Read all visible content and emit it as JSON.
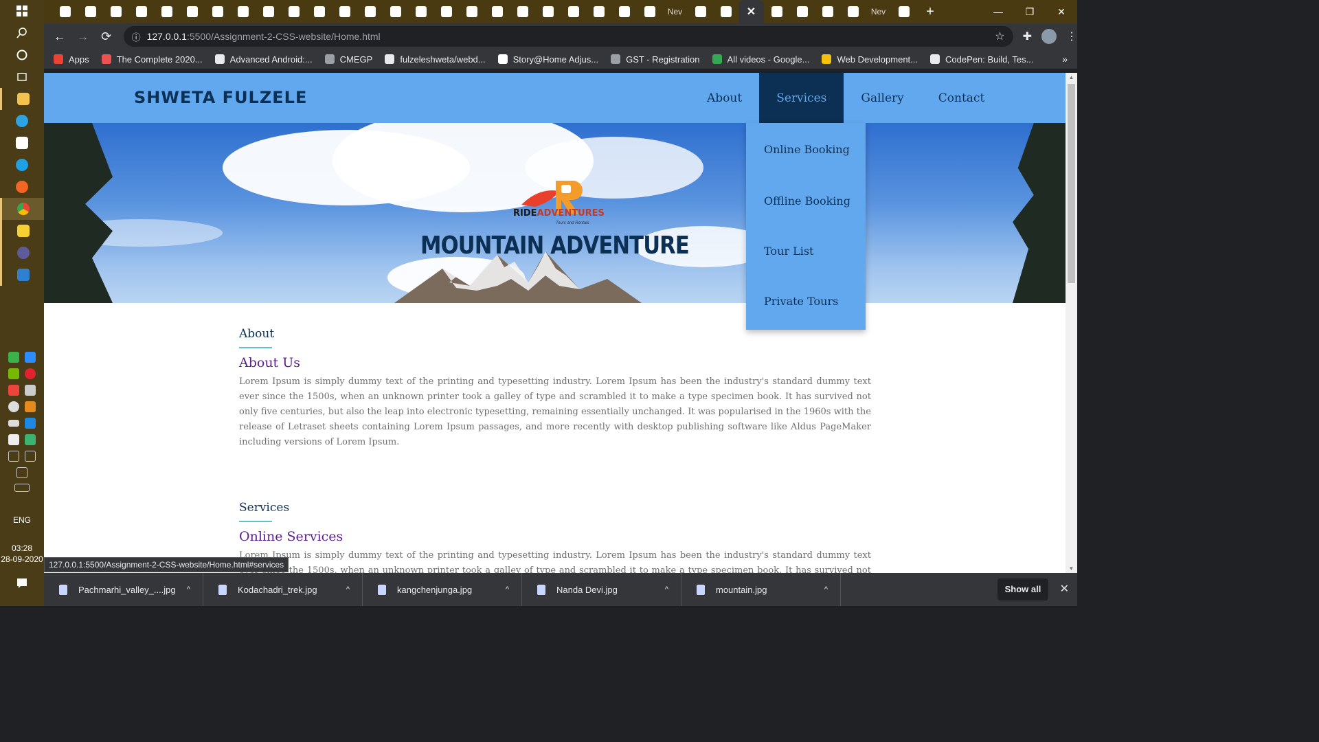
{
  "os": {
    "language": "ENG",
    "time": "03:28",
    "date": "28-09-2020"
  },
  "browser": {
    "tabs": [
      {
        "icon": "codepen-icon",
        "label": ""
      },
      {
        "icon": "codepen-icon",
        "label": ""
      },
      {
        "icon": "google-drive-icon",
        "label": ""
      },
      {
        "icon": "document-icon",
        "label": ""
      },
      {
        "icon": "w3schools-icon",
        "label": ""
      },
      {
        "icon": "w3schools-icon",
        "label": ""
      },
      {
        "icon": "google-drive-icon",
        "label": ""
      },
      {
        "icon": "w3schools-icon",
        "label": ""
      },
      {
        "icon": "slides-icon",
        "label": ""
      },
      {
        "icon": "gmail-icon",
        "label": ""
      },
      {
        "icon": "meet-icon",
        "label": ""
      },
      {
        "icon": "news-icon",
        "label": ""
      },
      {
        "icon": "frontend-icon",
        "label": ""
      },
      {
        "icon": "wordpress-icon",
        "label": ""
      },
      {
        "icon": "settings-icon",
        "label": ""
      },
      {
        "icon": "settings-icon",
        "label": ""
      },
      {
        "icon": "wordpress-icon",
        "label": ""
      },
      {
        "icon": "google-drive-icon",
        "label": ""
      },
      {
        "icon": "pen-icon",
        "label": ""
      },
      {
        "icon": "twitter-icon",
        "label": ""
      },
      {
        "icon": "codepen-icon",
        "label": ""
      },
      {
        "icon": "fx-icon",
        "label": ""
      },
      {
        "icon": "w3schools-icon",
        "label": ""
      },
      {
        "icon": "w3schools-icon",
        "label": ""
      },
      {
        "icon": "newtab-icon",
        "label": "Nev"
      },
      {
        "icon": "w3schools-icon",
        "label": ""
      },
      {
        "icon": "w3schools-icon",
        "label": ""
      }
    ],
    "current_tab_close": "✕",
    "tabs_after": [
      {
        "icon": "instagram-icon",
        "label": ""
      },
      {
        "icon": "google-icon",
        "label": ""
      },
      {
        "icon": "codepen-icon",
        "label": ""
      },
      {
        "icon": "linkedin-icon",
        "label": ""
      },
      {
        "icon": "newtab-icon",
        "label": "Nev"
      },
      {
        "icon": "google-icon",
        "label": ""
      }
    ],
    "new_tab_label": "+",
    "url_host": "127.0.0.1",
    "url_path": ":5500/Assignment-2-CSS-website/Home.html",
    "bookmarks": [
      {
        "label": "Apps",
        "color": "#ea4335"
      },
      {
        "label": "The Complete 2020...",
        "color": "#ec5252"
      },
      {
        "label": "Advanced Android:...",
        "color": "#e8eaed"
      },
      {
        "label": "CMEGP",
        "color": "#9aa0a6"
      },
      {
        "label": "fulzeleshweta/webd...",
        "color": "#e8eaed"
      },
      {
        "label": "Story@Home Adjus...",
        "color": "#ffffff"
      },
      {
        "label": "GST - Registration",
        "color": "#9aa0a6"
      },
      {
        "label": "All videos - Google...",
        "color": "#34a853"
      },
      {
        "label": "Web Development...",
        "color": "#f4c20d"
      },
      {
        "label": "CodePen: Build, Tes...",
        "color": "#e8eaed"
      }
    ],
    "bookmarks_more": "»",
    "status_url": "127.0.0.1:5500/Assignment-2-CSS-website/Home.html#services"
  },
  "site": {
    "brand": "SHWETA FULZELE",
    "nav": [
      "About",
      "Services",
      "Gallery",
      "Contact"
    ],
    "active_nav": "Services",
    "dropdown": [
      "Online Booking",
      "Offline Booking",
      "Tour List",
      "Private Tours"
    ],
    "hero": {
      "logo_main": "RIDE",
      "logo_accent": "ADVENTURES",
      "logo_tagline": "Tours and Rentals",
      "title": "MOUNTAIN ADVENTURE"
    },
    "sections": [
      {
        "label": "About",
        "heading": "About Us",
        "text": "Lorem Ipsum is simply dummy text of the printing and typesetting industry. Lorem Ipsum has been the industry's standard dummy text ever since the 1500s, when an unknown printer took a galley of type and scrambled it to make a type specimen book. It has survived not only five centuries, but also the leap into electronic typesetting, remaining essentially unchanged. It was popularised in the 1960s with the release of Letraset sheets containing Lorem Ipsum passages, and more recently with desktop publishing software like Aldus PageMaker including versions of Lorem Ipsum."
      },
      {
        "label": "Services",
        "heading": "Online Services",
        "text": "Lorem Ipsum is simply dummy text of the printing and typesetting industry. Lorem Ipsum has been the industry's standard dummy text ever since the 1500s, when an unknown printer took a galley of type and scrambled it to make a type specimen book. It has survived not only five centuries, but also the leap into electronic typesetting, remaining essentially unchanged. It was popularised in the 1960s with the release of Letraset sheets containing Lorem Ipsum passages, and more recently with desktop publishing software like Aldus PageMaker including versions of Lorem Ipsum."
      }
    ]
  },
  "downloads": {
    "files": [
      "Pachmarhi_valley_....jpg",
      "Kodachadri_trek.jpg",
      "kangchenjunga.jpg",
      "Nanda Devi.jpg",
      "mountain.jpg"
    ],
    "show_all": "Show all",
    "close": "✕"
  }
}
